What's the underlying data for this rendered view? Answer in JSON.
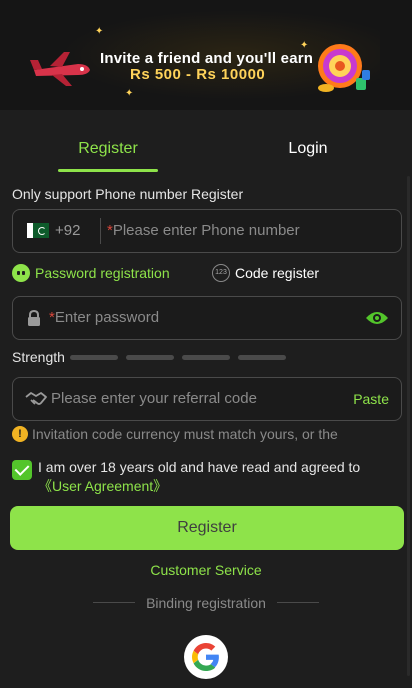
{
  "banner": {
    "line1": "Invite a friend and you'll earn",
    "line2": "Rs 500 - Rs 10000"
  },
  "tabs": {
    "register": "Register",
    "login": "Login"
  },
  "note": "Only support Phone number Register",
  "phone": {
    "country_code": "+92",
    "required_mark": "*",
    "placeholder": "Please enter Phone number"
  },
  "modes": {
    "password": "Password registration",
    "code": "Code register",
    "code_icon_text": "123"
  },
  "password": {
    "required_mark": "*",
    "placeholder": "Enter password"
  },
  "strength": {
    "label": "Strength",
    "level": 0
  },
  "referral": {
    "placeholder": "Please enter your referral code",
    "paste": "Paste"
  },
  "warning": "Invitation code currency must match yours, or the",
  "agreement": {
    "checked": true,
    "text": "I am over 18 years old and have read and agreed to ",
    "link": "《User Agreement》"
  },
  "register_button": "Register",
  "customer_service": "Customer Service",
  "binding": "Binding registration",
  "colors": {
    "accent": "#8ee34a",
    "background": "#1e1e1e",
    "warning": "#f1b323",
    "required": "#d9473b"
  },
  "icons": [
    "pakistan-flag-icon",
    "lock-icon",
    "eye-icon",
    "handshake-icon",
    "warning-icon",
    "check-icon",
    "google-icon"
  ]
}
